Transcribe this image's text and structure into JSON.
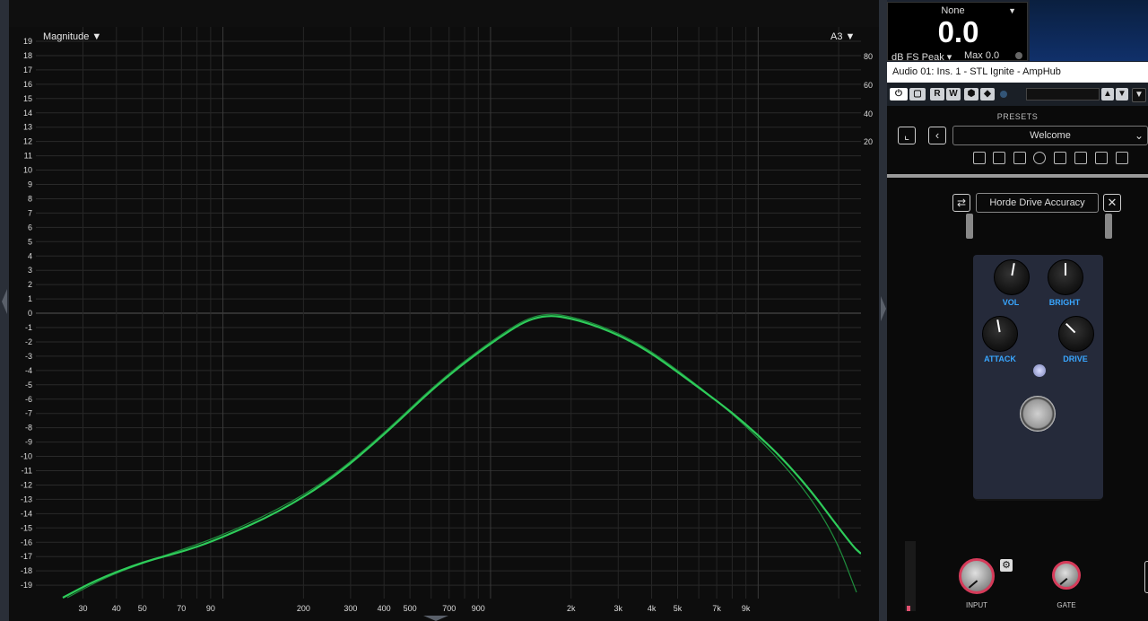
{
  "analyzer": {
    "magnitude_label": "Magnitude ▼",
    "channel_label": "A3 ▼",
    "y_ticks": [
      "19",
      "18",
      "17",
      "16",
      "15",
      "14",
      "13",
      "12",
      "11",
      "10",
      "9",
      "8",
      "7",
      "6",
      "5",
      "4",
      "3",
      "2",
      "1",
      "0",
      "-1",
      "-2",
      "-3",
      "-4",
      "-5",
      "-6",
      "-7",
      "-8",
      "-9",
      "-10",
      "-11",
      "-12",
      "-13",
      "-14",
      "-15",
      "-16",
      "-17",
      "-18",
      "-19"
    ],
    "right_ticks": [
      "80",
      "60",
      "40",
      "20"
    ],
    "x_ticks": [
      "30",
      "40",
      "50",
      "70",
      "90",
      "200",
      "300",
      "400",
      "500",
      "700",
      "900",
      "2k",
      "3k",
      "4k",
      "5k",
      "7k",
      "9k"
    ],
    "curve_color": "#2ecc5a",
    "curve2_color": "#1f8c3c"
  },
  "meter": {
    "source": "None",
    "value": "0.0",
    "mode": "dB FS Peak ▾",
    "max": "Max 0.0"
  },
  "plugin": {
    "title": "Audio 01: Ins. 1 - STL Ignite - AmpHub",
    "toolbar": {
      "read": "R",
      "write": "W"
    },
    "presets_title": "PRESETS",
    "preset_name": "Welcome",
    "amp_name": "Horde Drive Accuracy",
    "knobs": {
      "vol": "VOL",
      "bright": "BRIGHT",
      "attack": "ATTACK",
      "drive": "DRIVE"
    },
    "bottom": {
      "input": "INPUT",
      "gate": "GATE"
    },
    "accent_color": "#d63b5a",
    "label_color": "#39a6ff"
  }
}
